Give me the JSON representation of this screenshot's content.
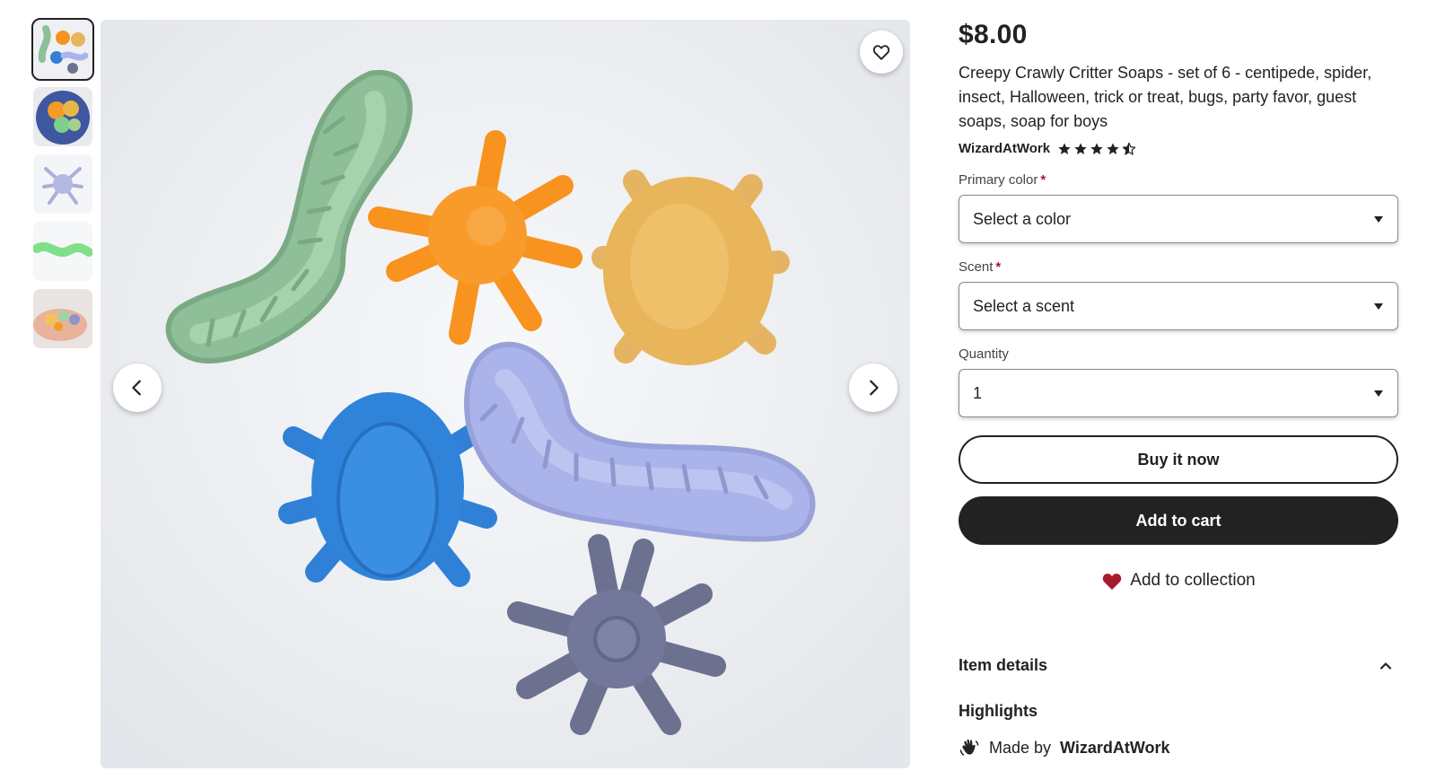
{
  "gallery": {
    "thumbnails": [
      {
        "name": "thumb-1",
        "active": true
      },
      {
        "name": "thumb-2",
        "active": false
      },
      {
        "name": "thumb-3",
        "active": false
      },
      {
        "name": "thumb-4",
        "active": false
      },
      {
        "name": "thumb-5",
        "active": false
      }
    ],
    "icons": {
      "favorite": "heart-outline-icon",
      "previous": "chevron-left-icon",
      "next": "chevron-right-icon"
    }
  },
  "product": {
    "price": "$8.00",
    "title": "Creepy Crawly Critter Soaps - set of 6 - centipede, spider, insect, Halloween, trick or treat, bugs, party favor, guest soaps, soap for boys",
    "shop_name": "WizardAtWork",
    "rating": 4.5,
    "rating_max": 5
  },
  "options": {
    "primary_color": {
      "label": "Primary color",
      "required_mark": "*",
      "value": "Select a color"
    },
    "scent": {
      "label": "Scent",
      "required_mark": "*",
      "value": "Select a scent"
    },
    "quantity": {
      "label": "Quantity",
      "value": "1"
    }
  },
  "actions": {
    "buy_now": "Buy it now",
    "add_to_cart": "Add to cart",
    "add_to_collection": "Add to collection"
  },
  "details": {
    "section_title": "Item details",
    "highlights_title": "Highlights",
    "made_by_prefix": "Made by",
    "made_by_shop": "WizardAtWork"
  },
  "colors": {
    "text": "#222222",
    "required": "#a61a2e",
    "heart": "#a61a2e",
    "button_dark": "#222222",
    "image_bg": "#eceef1"
  }
}
